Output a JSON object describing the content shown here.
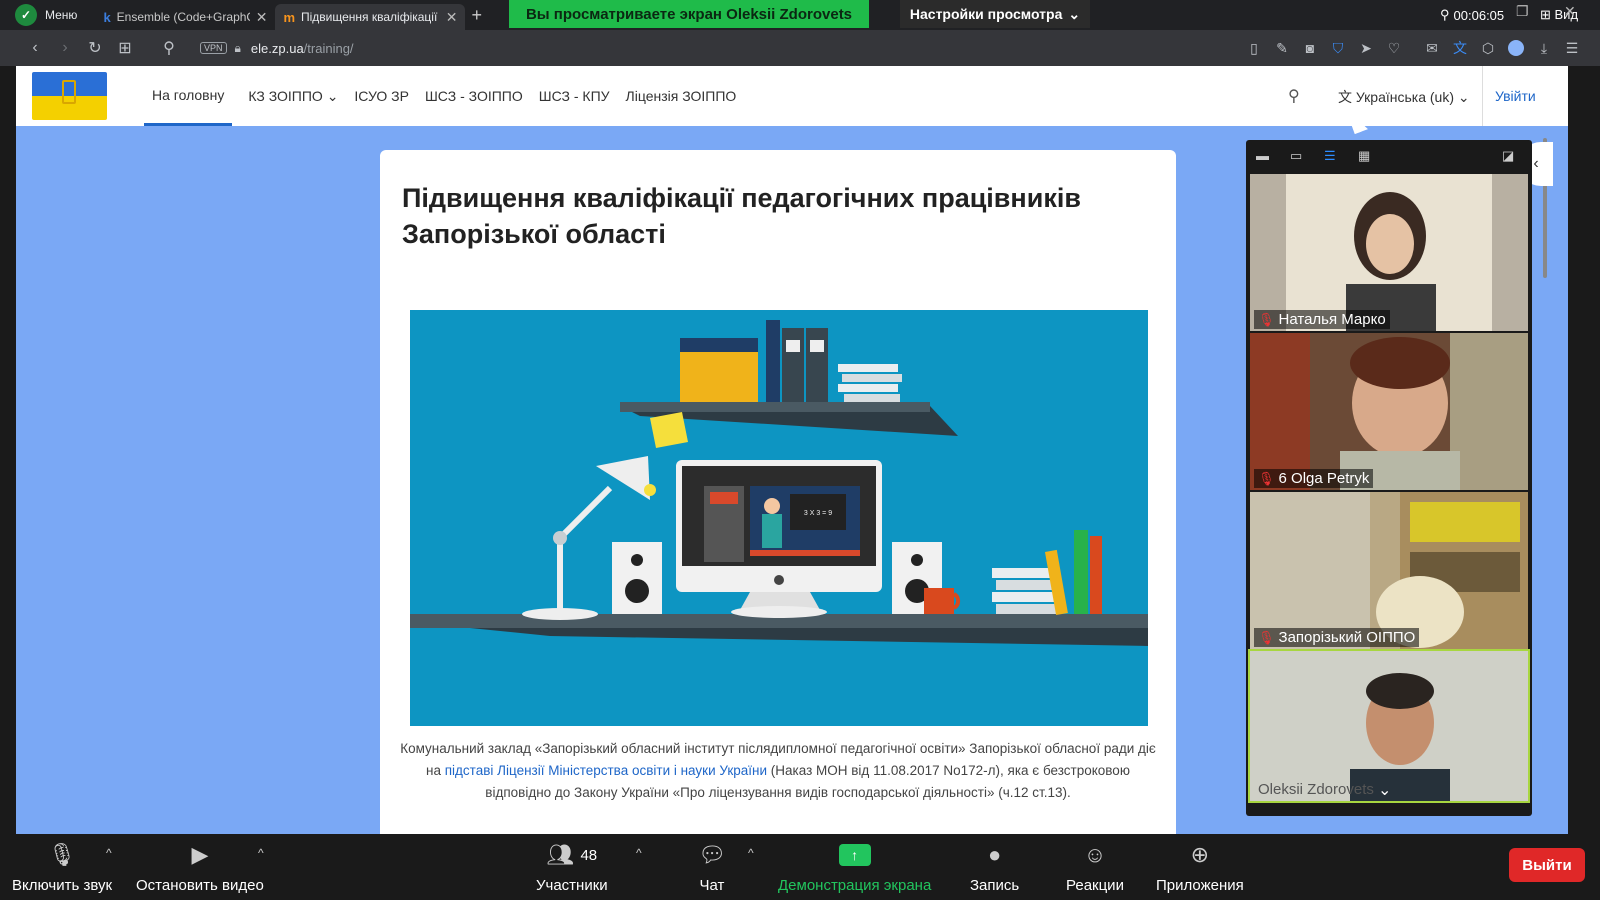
{
  "browser": {
    "menu_label": "Меню",
    "tabs": [
      {
        "title": "Ensemble (Code+GraphCo",
        "fav": "k"
      },
      {
        "title": "Підвищення кваліфікації",
        "fav": "m"
      }
    ],
    "new_tab": "+",
    "url_host": "ele.zp.ua",
    "url_path": "/training/",
    "vpn": "VPN"
  },
  "zoom_top": {
    "share_banner": "Вы просматриваете экран Oleksii Zdorovets",
    "view_settings": "Настройки просмотра",
    "timer": "00:06:05",
    "view_label": "Вид"
  },
  "site": {
    "nav": [
      "На головну",
      "КЗ ЗОІППО",
      "ІСУО ЗР",
      "ШСЗ - ЗОІППО",
      "ШСЗ - КПУ",
      "Ліцензія ЗОІППО"
    ],
    "language": "Українська (uk)",
    "login": "Увійти",
    "title": "Підвищення кваліфікації педагогічних працівників Запорізької області",
    "text_a": "Комунальний заклад «Запорізький обласний інститут післядипломної педагогічної освіти» Запорізької обласної ради  діє на ",
    "text_link": "підставі Ліцензії Міністерства освіти і науки України",
    "text_b": "  (Наказ  МОН від 11.08.2017 No172-л), яка є безстроковою відповідно до Закону України «Про ліцензування видів господарської діяльності» (ч.12 ст.13).",
    "board_text": "3 X 3 = 9"
  },
  "participants": [
    {
      "name": "Наталья Марко",
      "muted": true
    },
    {
      "name": "6 Olga Petryk",
      "muted": true
    },
    {
      "name": "Запорізький ОІППО",
      "muted": true
    },
    {
      "name": "Oleksii Zdorovets",
      "muted": false
    }
  ],
  "toolbar": {
    "audio": "Включить звук",
    "video": "Остановить видео",
    "participants": "Участники",
    "participants_count": "48",
    "chat": "Чат",
    "share": "Демонстрация экрана",
    "record": "Запись",
    "reactions": "Реакции",
    "apps": "Приложения",
    "leave": "Выйти"
  },
  "colors": {
    "share_green": "#1fbb4a",
    "leave_red": "#e02828",
    "site_bg": "#7aa8f5",
    "link_blue": "#1e66c8",
    "hero_bg": "#0d95c2"
  }
}
